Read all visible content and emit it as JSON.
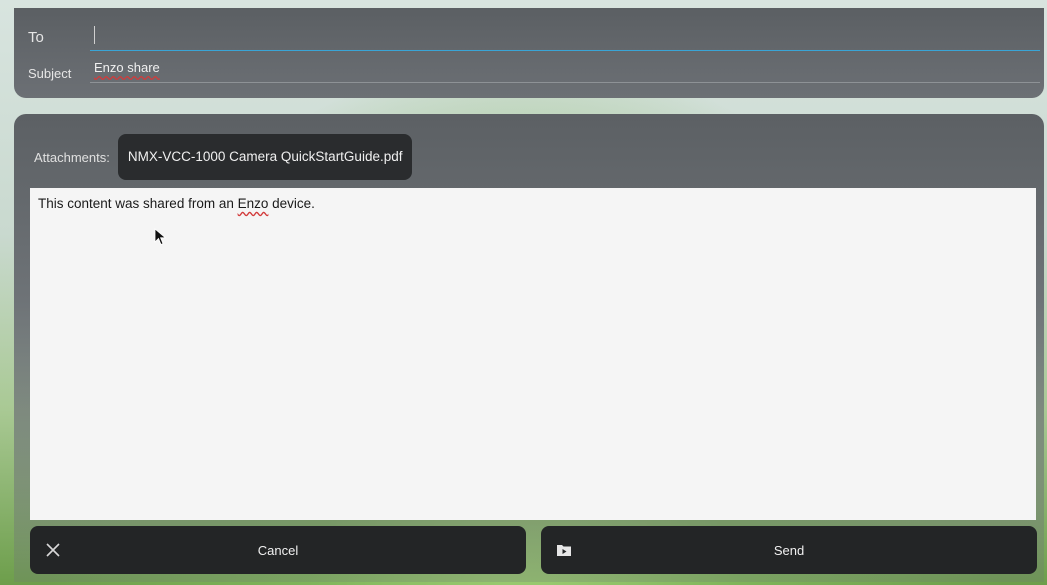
{
  "header": {
    "to_label": "To",
    "to_value": "",
    "subject_label": "Subject",
    "subject_value": "Enzo share"
  },
  "compose": {
    "attachments_label": "Attachments:",
    "attachment_name": "NMX-VCC-1000 Camera QuickStartGuide.pdf",
    "body_prefix": "This content was shared from an ",
    "body_misspelled": "Enzo",
    "body_suffix": " device."
  },
  "actions": {
    "cancel_label": "Cancel",
    "send_label": "Send"
  },
  "icons": {
    "cancel": "close-icon",
    "send": "send-icon",
    "pointer": "mouse-pointer-icon"
  },
  "colors": {
    "accent": "#3aa5d6",
    "spellcheck": "#d23b3b"
  }
}
